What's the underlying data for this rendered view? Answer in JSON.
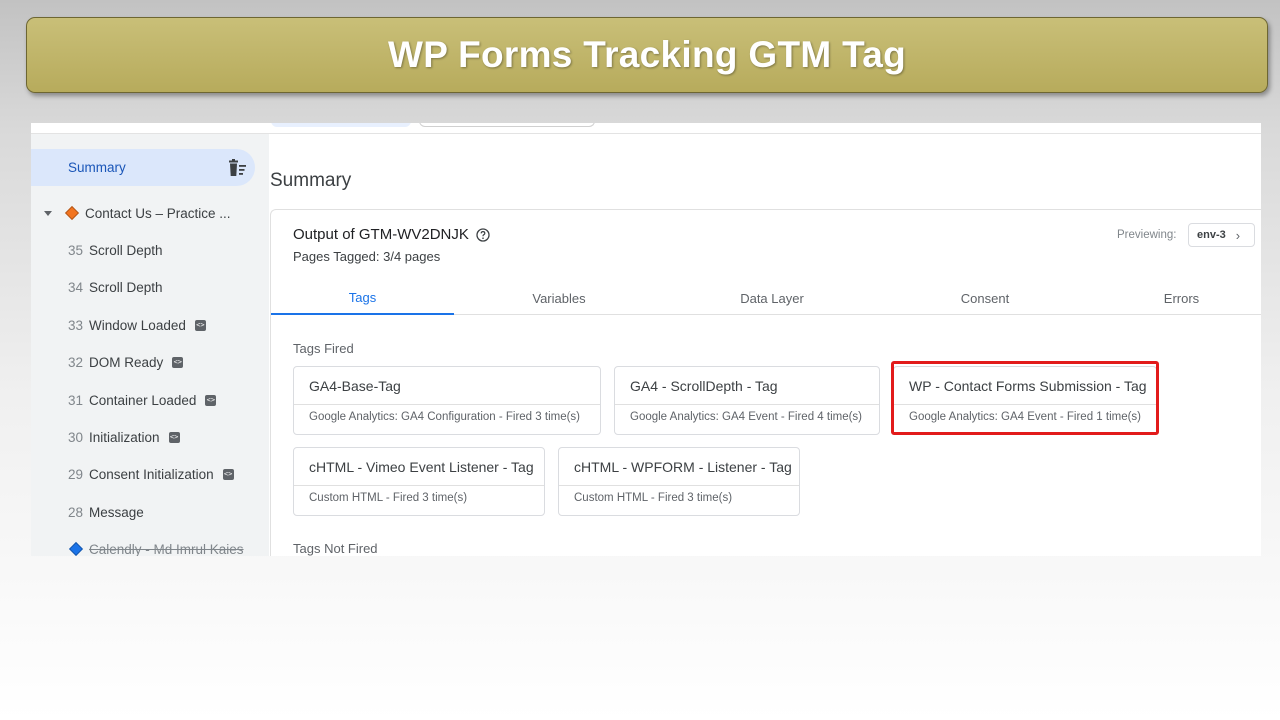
{
  "banner": {
    "title": "WP Forms Tracking GTM Tag"
  },
  "sidebar": {
    "summary_label": "Summary",
    "page_label": "Contact Us – Practice ...",
    "events": [
      {
        "num": "35",
        "label": "Scroll Depth",
        "code": false
      },
      {
        "num": "34",
        "label": "Scroll Depth",
        "code": false
      },
      {
        "num": "33",
        "label": "Window Loaded",
        "code": true
      },
      {
        "num": "32",
        "label": "DOM Ready",
        "code": true
      },
      {
        "num": "31",
        "label": "Container Loaded",
        "code": true
      },
      {
        "num": "30",
        "label": "Initialization",
        "code": true
      },
      {
        "num": "29",
        "label": "Consent Initialization",
        "code": true
      },
      {
        "num": "28",
        "label": "Message",
        "code": false
      }
    ],
    "next_page_label": "Calendly - Md Imrul Kaies"
  },
  "main": {
    "title": "Summary",
    "output_title": "Output of GTM-WV2DNJK",
    "pages_tagged": "Pages Tagged: 3/4 pages",
    "previewing_label": "Previewing:",
    "env_label": "env-3",
    "tabs": [
      {
        "label": "Tags",
        "active": true
      },
      {
        "label": "Variables",
        "active": false
      },
      {
        "label": "Data Layer",
        "active": false
      },
      {
        "label": "Consent",
        "active": false
      },
      {
        "label": "Errors",
        "active": false
      }
    ],
    "tags_fired_label": "Tags Fired",
    "tags_fired": [
      {
        "name": "GA4-Base-Tag",
        "meta": "Google Analytics: GA4 Configuration - Fired 3 time(s)"
      },
      {
        "name": "GA4 - ScrollDepth - Tag",
        "meta": "Google Analytics: GA4 Event - Fired 4 time(s)"
      },
      {
        "name": "WP - Contact Forms Submission - Tag",
        "meta": "Google Analytics: GA4 Event - Fired 1 time(s)",
        "highlighted": true
      },
      {
        "name": "cHTML - Vimeo Event Listener - Tag",
        "meta": "Custom HTML - Fired 3 time(s)"
      },
      {
        "name": "cHTML - WPFORM - Listener - Tag",
        "meta": "Custom HTML - Fired 3 time(s)"
      }
    ],
    "tags_not_fired_label": "Tags Not Fired"
  },
  "colors": {
    "banner": "#bfb367",
    "accent": "#1a73e8",
    "highlight": "#e21b1b",
    "trigger_page": "#f2741f"
  }
}
